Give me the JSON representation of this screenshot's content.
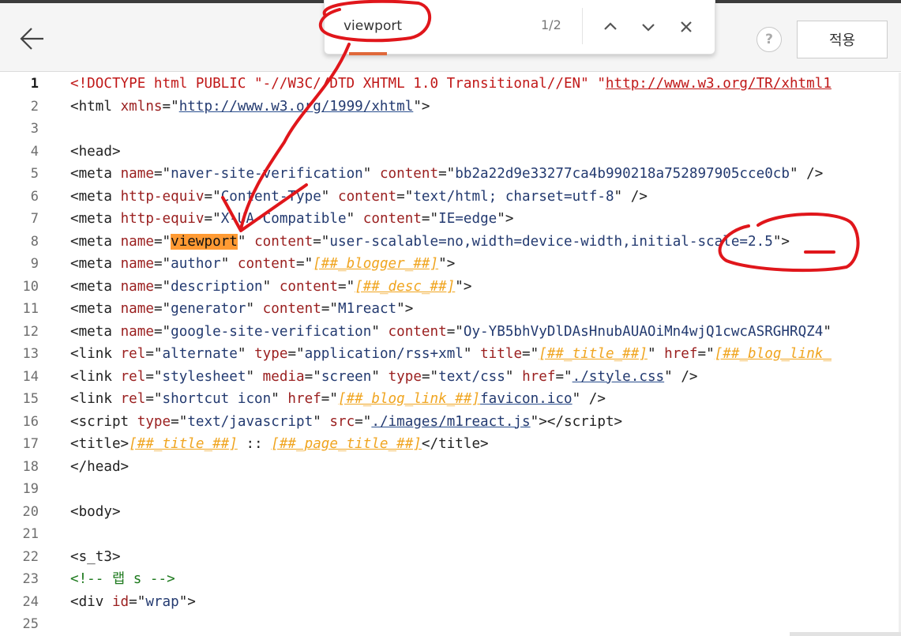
{
  "toolbar": {
    "apply_label": "적용",
    "help_label": "?"
  },
  "find": {
    "query": "viewport",
    "count": "1/2"
  },
  "icons": {
    "back": "arrow-left-icon",
    "help": "question-icon",
    "prev": "chevron-up-icon",
    "next": "chevron-down-icon",
    "close": "close-icon"
  },
  "colors": {
    "tag": "#222222",
    "attribute": "#9a1f1f",
    "value": "#233a70",
    "placeholder": "#f0a520",
    "comment": "#1e7a1e",
    "highlight": "#ff9a33",
    "annotation": "#e0161b"
  },
  "editor": {
    "active_line": 1,
    "lines": [
      {
        "n": "1",
        "html": "<span class=\"dt\">&lt;!DOCTYPE html PUBLIC \"-//W3C//DTD XHTML 1.0 Transitional//EN\" \"</span><span class=\"du\">http://www.w3.org/TR/xhtml1</span>"
      },
      {
        "n": "2",
        "html": "<span class=\"t\">&lt;html </span><span class=\"a\">xmlns</span><span class=\"t\">=\"</span><span class=\"u\">http://www.w3.org/1999/xhtml</span><span class=\"t\">\"&gt;</span>"
      },
      {
        "n": "3",
        "html": ""
      },
      {
        "n": "4",
        "html": "<span class=\"t\">&lt;head&gt;</span>"
      },
      {
        "n": "5",
        "html": "<span class=\"t\">&lt;meta </span><span class=\"a\">name</span><span class=\"t\">=\"</span><span class=\"v\">naver-site-verification</span><span class=\"t\">\" </span><span class=\"a\">content</span><span class=\"t\">=\"</span><span class=\"v\">bb2a22d9e33277ca4b990218a752897905cce0cb</span><span class=\"t\">\" /&gt;</span>"
      },
      {
        "n": "6",
        "html": "<span class=\"t\">&lt;meta </span><span class=\"a\">http-equiv</span><span class=\"t\">=\"</span><span class=\"v\">Content-Type</span><span class=\"t\">\" </span><span class=\"a\">content</span><span class=\"t\">=\"</span><span class=\"v\">text/html; charset=utf-8</span><span class=\"t\">\" /&gt;</span>"
      },
      {
        "n": "7",
        "html": "<span class=\"t\">&lt;meta </span><span class=\"a\">http-equiv</span><span class=\"t\">=\"</span><span class=\"v\">X-UA-Compatible</span><span class=\"t\">\" </span><span class=\"a\">content</span><span class=\"t\">=\"</span><span class=\"v\">IE=edge</span><span class=\"t\">\"&gt;</span>"
      },
      {
        "n": "8",
        "html": "<span class=\"t\">&lt;meta </span><span class=\"a\">name</span><span class=\"t\">=\"</span><span class=\"hl\">viewport</span><span class=\"t\">\" </span><span class=\"a\">content</span><span class=\"t\">=\"</span><span class=\"v\">user-scalable=no,width=device-width,initial-scale=2.5</span><span class=\"t\">\"&gt;</span>"
      },
      {
        "n": "9",
        "html": "<span class=\"t\">&lt;meta </span><span class=\"a\">name</span><span class=\"t\">=\"</span><span class=\"v\">author</span><span class=\"t\">\" </span><span class=\"a\">content</span><span class=\"t\">=\"</span><span class=\"ph\">[##_blogger_##]</span><span class=\"t\">\"&gt;</span>"
      },
      {
        "n": "10",
        "html": "<span class=\"t\">&lt;meta </span><span class=\"a\">name</span><span class=\"t\">=\"</span><span class=\"v\">description</span><span class=\"t\">\" </span><span class=\"a\">content</span><span class=\"t\">=\"</span><span class=\"ph\">[##_desc_##]</span><span class=\"t\">\"&gt;</span>"
      },
      {
        "n": "11",
        "html": "<span class=\"t\">&lt;meta </span><span class=\"a\">name</span><span class=\"t\">=\"</span><span class=\"v\">generator</span><span class=\"t\">\" </span><span class=\"a\">content</span><span class=\"t\">=\"</span><span class=\"v\">M1react</span><span class=\"t\">\"&gt;</span>"
      },
      {
        "n": "12",
        "html": "<span class=\"t\">&lt;meta </span><span class=\"a\">name</span><span class=\"t\">=\"</span><span class=\"v\">google-site-verification</span><span class=\"t\">\" </span><span class=\"a\">content</span><span class=\"t\">=\"</span><span class=\"v\">Oy-YB5bhVyDlDAsHnubAUAOiMn4wjQ1cwcASRGHRQZ4</span><span class=\"t\">\"</span>"
      },
      {
        "n": "13",
        "html": "<span class=\"t\">&lt;link </span><span class=\"a\">rel</span><span class=\"t\">=\"</span><span class=\"v\">alternate</span><span class=\"t\">\" </span><span class=\"a\">type</span><span class=\"t\">=\"</span><span class=\"v\">application/rss+xml</span><span class=\"t\">\" </span><span class=\"a\">title</span><span class=\"t\">=\"</span><span class=\"ph\">[##_title_##]</span><span class=\"t\">\" </span><span class=\"a\">href</span><span class=\"t\">=\"</span><span class=\"ph\">[##_blog_link_</span>"
      },
      {
        "n": "14",
        "html": "<span class=\"t\">&lt;link </span><span class=\"a\">rel</span><span class=\"t\">=\"</span><span class=\"v\">stylesheet</span><span class=\"t\">\" </span><span class=\"a\">media</span><span class=\"t\">=\"</span><span class=\"v\">screen</span><span class=\"t\">\" </span><span class=\"a\">type</span><span class=\"t\">=\"</span><span class=\"v\">text/css</span><span class=\"t\">\" </span><span class=\"a\">href</span><span class=\"t\">=\"</span><span class=\"u\">./style.css</span><span class=\"t\">\" /&gt;</span>"
      },
      {
        "n": "15",
        "html": "<span class=\"t\">&lt;link </span><span class=\"a\">rel</span><span class=\"t\">=\"</span><span class=\"v\">shortcut icon</span><span class=\"t\">\" </span><span class=\"a\">href</span><span class=\"t\">=\"</span><span class=\"ph\">[##_blog_link_##]</span><span class=\"u\">favicon.ico</span><span class=\"t\">\" /&gt;</span>"
      },
      {
        "n": "16",
        "html": "<span class=\"t\">&lt;script </span><span class=\"a\">type</span><span class=\"t\">=\"</span><span class=\"v\">text/javascript</span><span class=\"t\">\" </span><span class=\"a\">src</span><span class=\"t\">=\"</span><span class=\"u\">./images/m1react.js</span><span class=\"t\">\"&gt;&lt;/script&gt;</span>"
      },
      {
        "n": "17",
        "html": "<span class=\"t\">&lt;title&gt;</span><span class=\"ph\">[##_title_##]</span><span class=\"t\"> :: </span><span class=\"ph\">[##_page_title_##]</span><span class=\"t\">&lt;/title&gt;</span>"
      },
      {
        "n": "18",
        "html": "<span class=\"t\">&lt;/head&gt;</span>"
      },
      {
        "n": "19",
        "html": ""
      },
      {
        "n": "20",
        "html": "<span class=\"t\">&lt;body&gt;</span>"
      },
      {
        "n": "21",
        "html": ""
      },
      {
        "n": "22",
        "html": "<span class=\"t\">&lt;s_t3&gt;</span>"
      },
      {
        "n": "23",
        "html": "<span class=\"c\">&lt;!-- 랩 s --&gt;</span>"
      },
      {
        "n": "24",
        "html": "<span class=\"t\">&lt;div </span><span class=\"a\">id</span><span class=\"t\">=\"</span><span class=\"v\">wrap</span><span class=\"t\">\"&gt;</span>"
      },
      {
        "n": "25",
        "html": ""
      }
    ]
  }
}
